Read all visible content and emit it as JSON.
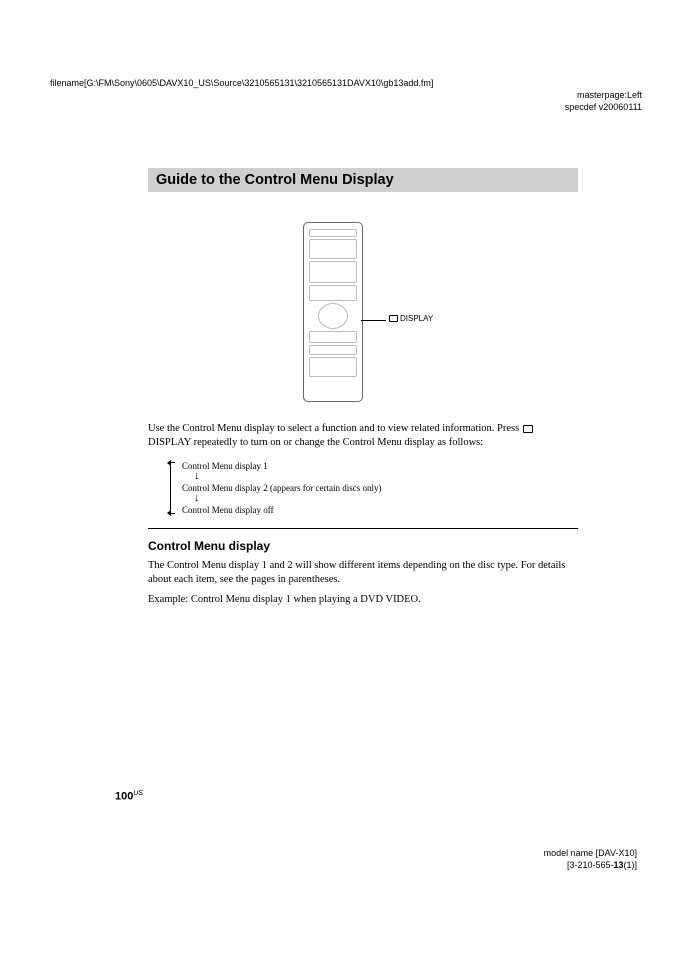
{
  "meta": {
    "filename": "filename[G:\\FM\\Sony\\0605\\DAVX10_US\\Source\\3210565131\\3210565131DAVX10\\gb13add.fm]",
    "masterpage": "masterpage:Left",
    "specdef": "specdef v20060111"
  },
  "title": "Guide to the Control Menu Display",
  "remote_label": "DISPLAY",
  "intro_p1_a": "Use the Control Menu display to select a function and to view related information. Press ",
  "intro_p1_b": " DISPLAY repeatedly to turn on or change the Control Menu display as follows:",
  "flow": {
    "item1": "Control Menu display 1",
    "item2": "Control Menu display 2 (appears for certain discs only)",
    "item3": "Control Menu display off"
  },
  "subheading": "Control Menu display",
  "para2": "The Control Menu display 1 and 2 will show different items depending on the disc type. For details about each item, see the pages in parentheses.",
  "para3": "Example: Control Menu display 1 when playing a DVD VIDEO.",
  "page_number": "100",
  "page_region": "US",
  "footer": {
    "model": "model name [DAV-X10]",
    "part_a": "[3-210-565-",
    "part_b": "13",
    "part_c": "(1)]"
  }
}
